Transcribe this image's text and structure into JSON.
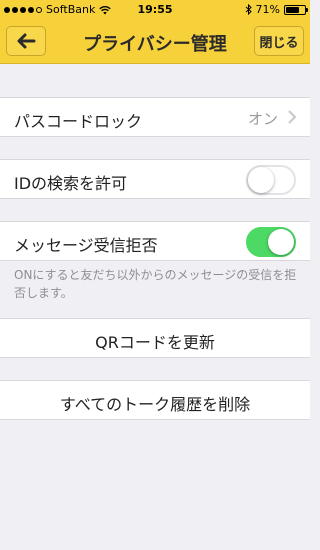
{
  "status_bar": {
    "carrier": "SoftBank",
    "time": "19:55",
    "battery_text": "71%",
    "battery_level": 0.71,
    "signal_dots": 5
  },
  "nav": {
    "title": "プライバシー管理",
    "close_label": "閉じる",
    "back_icon": "arrow-left-icon"
  },
  "rows": {
    "passcode": {
      "label": "パスコードロック",
      "value": "オン"
    },
    "id_search": {
      "label": "IDの検索を許可",
      "toggle_on": false
    },
    "reject_messages": {
      "label": "メッセージ受信拒否",
      "toggle_on": true
    },
    "reject_note": "ONにすると友だち以外からのメッセージの受信を拒否します。",
    "qr_update": {
      "label": "QRコードを更新"
    },
    "delete_history": {
      "label": "すべてのトーク履歴を削除"
    }
  },
  "colors": {
    "nav_yellow": "#f6d13a",
    "toggle_green": "#4cd964",
    "background": "#efeff4"
  }
}
